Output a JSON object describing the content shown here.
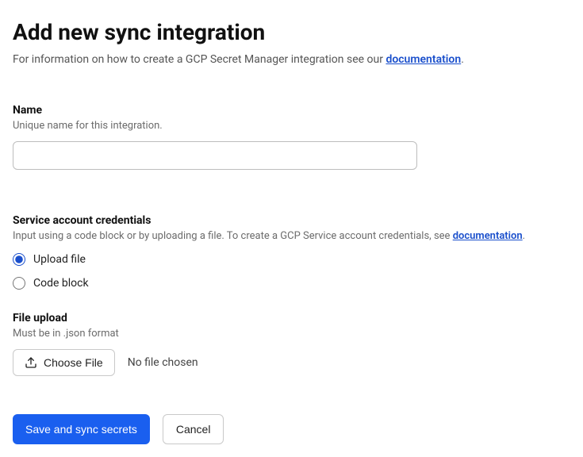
{
  "page": {
    "title": "Add new sync integration",
    "subtitle_prefix": "For information on how to create a GCP Secret Manager integration see our ",
    "subtitle_link": "documentation",
    "subtitle_suffix": "."
  },
  "name_field": {
    "label": "Name",
    "hint": "Unique name for this integration.",
    "value": ""
  },
  "credentials": {
    "label": "Service account credentials",
    "hint_prefix": "Input using a code block or by uploading a file. To create a GCP Service account credentials, see ",
    "hint_link": "documentation",
    "hint_suffix": ".",
    "options": {
      "upload": "Upload file",
      "code": "Code block"
    },
    "selected": "upload"
  },
  "file_upload": {
    "label": "File upload",
    "hint": "Must be in .json format",
    "button": "Choose File",
    "status": "No file chosen"
  },
  "buttons": {
    "save": "Save and sync secrets",
    "cancel": "Cancel"
  }
}
